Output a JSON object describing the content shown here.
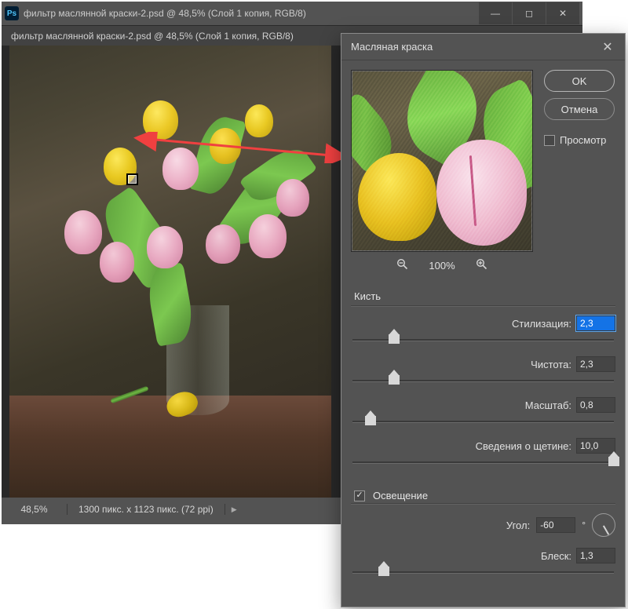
{
  "window": {
    "title": "фильтр маслянной краски-2.psd @ 48,5% (Слой 1 копия, RGB/8)",
    "tab_title": "фильтр маслянной краски-2.psd @ 48,5% (Слой 1 копия, RGB/8)"
  },
  "status": {
    "zoom": "48,5%",
    "dimensions": "1300 пикс. x 1123 пикс. (72 ppi)"
  },
  "dialog": {
    "title": "Масляная краска",
    "ok": "OK",
    "cancel": "Отмена",
    "preview_label": "Просмотр",
    "preview_checked": false,
    "zoom_level": "100%",
    "sections": {
      "brush": {
        "title": "Кисть",
        "stylization": {
          "label": "Стилизация:",
          "value": "2,3",
          "pos": 16
        },
        "cleanliness": {
          "label": "Чистота:",
          "value": "2,3",
          "pos": 16
        },
        "scale": {
          "label": "Масштаб:",
          "value": "0,8",
          "pos": 7
        },
        "bristle": {
          "label": "Сведения о щетине:",
          "value": "10,0",
          "pos": 100
        }
      },
      "lighting": {
        "title": "Освещение",
        "checked": true,
        "angle": {
          "label": "Угол:",
          "value": "-60",
          "degree": "°"
        },
        "shine": {
          "label": "Блеск:",
          "value": "1,3",
          "pos": 12
        }
      }
    }
  }
}
